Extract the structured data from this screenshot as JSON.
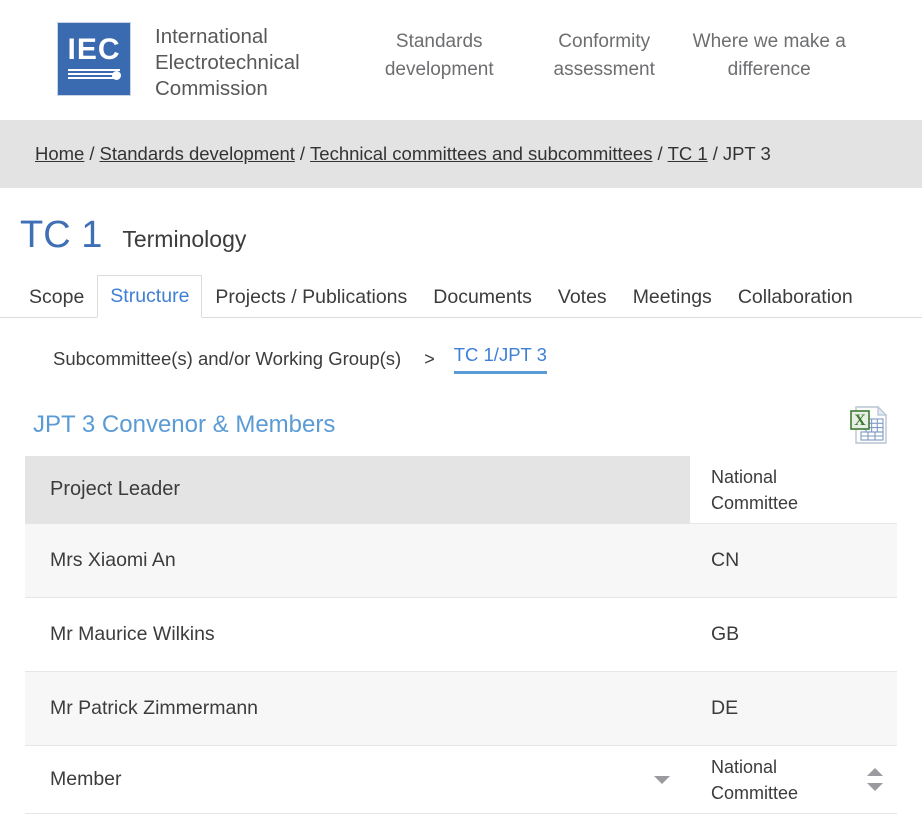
{
  "header": {
    "logo": {
      "letters": "IEC",
      "alt": "iec-logo"
    },
    "brand_name": "International\nElectrotechnical\nCommission",
    "nav": [
      {
        "label": "Standards\ndevelopment",
        "name": "standards-development"
      },
      {
        "label": "Conformity\nassessment",
        "name": "conformity-assessment"
      },
      {
        "label": "Where we make a\ndifference",
        "name": "where-we-make-a-difference"
      }
    ]
  },
  "breadcrumb": {
    "separator": "/",
    "items": [
      {
        "label": "Home",
        "link": true
      },
      {
        "label": "Standards development",
        "link": true
      },
      {
        "label": "Technical committees and subcommittees",
        "link": true
      },
      {
        "label": "TC 1",
        "link": true
      },
      {
        "label": "JPT 3",
        "link": false
      }
    ]
  },
  "page": {
    "code": "TC 1",
    "name": "Terminology"
  },
  "tabs": [
    {
      "label": "Scope",
      "active": false
    },
    {
      "label": "Structure",
      "active": true
    },
    {
      "label": "Projects / Publications",
      "active": false
    },
    {
      "label": "Documents",
      "active": false
    },
    {
      "label": "Votes",
      "active": false
    },
    {
      "label": "Meetings",
      "active": false
    },
    {
      "label": "Collaboration",
      "active": false
    }
  ],
  "subnav": {
    "label": "Subcommittee(s) and/or Working Group(s)",
    "separator": ">",
    "active": "TC 1/JPT 3"
  },
  "section": {
    "title": "JPT 3 Convenor & Members",
    "export_icon": "excel-export-icon"
  },
  "table": {
    "leader_header": {
      "role": "Project Leader",
      "committee": "National\nCommittee"
    },
    "leader_rows": [
      {
        "name": "Mrs Xiaomi An",
        "committee": "CN"
      },
      {
        "name": "Mr Maurice Wilkins",
        "committee": "GB"
      },
      {
        "name": "Mr Patrick Zimmermann",
        "committee": "DE"
      }
    ],
    "member_header": {
      "role": "Member",
      "committee": "National\nCommittee"
    }
  },
  "colors": {
    "brand_blue": "#3a6ab0",
    "link_blue": "#3f7fd6",
    "heading_blue": "#5b9bd5",
    "bar_gray": "#e3e3e3",
    "row_shade": "#f7f7f7"
  }
}
